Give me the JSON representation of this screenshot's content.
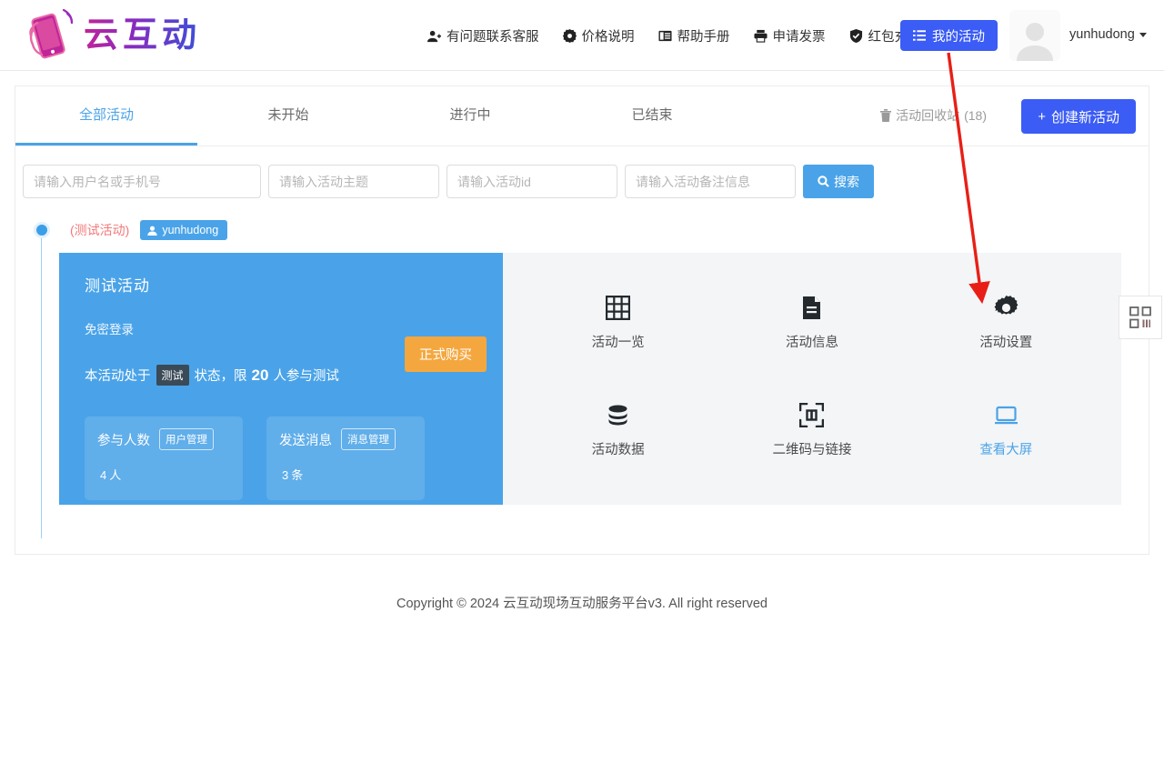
{
  "brand": {
    "name": "云互动",
    "logo_icon": "hand-phone-logo",
    "gradient_from": "#c0249a",
    "gradient_to": "#3b4fd8"
  },
  "header": {
    "nav": [
      {
        "label": "有问题联系客服",
        "icon": "user-support-icon"
      },
      {
        "label": "价格说明",
        "icon": "price-tag-icon"
      },
      {
        "label": "帮助手册",
        "icon": "book-icon"
      },
      {
        "label": "申请发票",
        "icon": "printer-icon"
      },
      {
        "label": "红包充值",
        "icon": "shield-check-icon"
      }
    ],
    "my_activity_button": {
      "label": "我的活动",
      "icon": "list-icon",
      "color": "#3b5cf5"
    },
    "avatar_icon": "user-avatar-placeholder",
    "username": "yunhudong",
    "caret_icon": "chevron-down-icon"
  },
  "tabs": [
    {
      "label": "全部活动",
      "active": true
    },
    {
      "label": "未开始",
      "active": false
    },
    {
      "label": "进行中",
      "active": false
    },
    {
      "label": "已结束",
      "active": false
    }
  ],
  "toolbar": {
    "recycle_bin": {
      "label": "活动回收站",
      "count": "(18)",
      "icon": "trash-icon"
    },
    "create_button": {
      "label": "创建新活动",
      "plus": "+",
      "color": "#3b5cf5"
    }
  },
  "search": {
    "fields": [
      {
        "placeholder": "请输入用户名或手机号",
        "value": ""
      },
      {
        "placeholder": "请输入活动主题",
        "value": ""
      },
      {
        "placeholder": "请输入活动id",
        "value": ""
      },
      {
        "placeholder": "请输入活动备注信息",
        "value": ""
      }
    ],
    "button": {
      "label": "搜索",
      "icon": "search-icon",
      "color": "#4aa3e8"
    }
  },
  "activity": {
    "test_tag": "(测试活动)",
    "owner": {
      "label": "yunhudong",
      "icon": "user-icon"
    },
    "card": {
      "title": "测试活动",
      "subtitle": "免密登录",
      "status_prefix": "本活动处于",
      "status_badge": "测试",
      "status_middle": "状态，限",
      "status_limit": "20",
      "status_suffix": "人参与测试",
      "buy_button": {
        "label": "正式购买",
        "color": "#f5a73f"
      },
      "stats": [
        {
          "label": "参与人数",
          "action": "用户管理",
          "value": "4",
          "unit": "人"
        },
        {
          "label": "发送消息",
          "action": "消息管理",
          "value": "3",
          "unit": "条"
        }
      ]
    },
    "actions": [
      {
        "label": "活动一览",
        "icon": "grid-icon",
        "highlight": false
      },
      {
        "label": "活动信息",
        "icon": "document-icon",
        "highlight": false
      },
      {
        "label": "活动设置",
        "icon": "gear-icon",
        "highlight": false
      },
      {
        "label": "活动数据",
        "icon": "database-icon",
        "highlight": false
      },
      {
        "label": "二维码与链接",
        "icon": "scan-icon",
        "highlight": false
      },
      {
        "label": "查看大屏",
        "icon": "monitor-icon",
        "highlight": true
      }
    ]
  },
  "side_tab": {
    "icon": "qrcode-icon"
  },
  "footer": {
    "text": "Copyright © 2024 云互动现场互动服务平台v3. All right reserved"
  },
  "annotation": {
    "type": "red-arrow",
    "color": "#e81f17",
    "points_to": "活动设置"
  }
}
